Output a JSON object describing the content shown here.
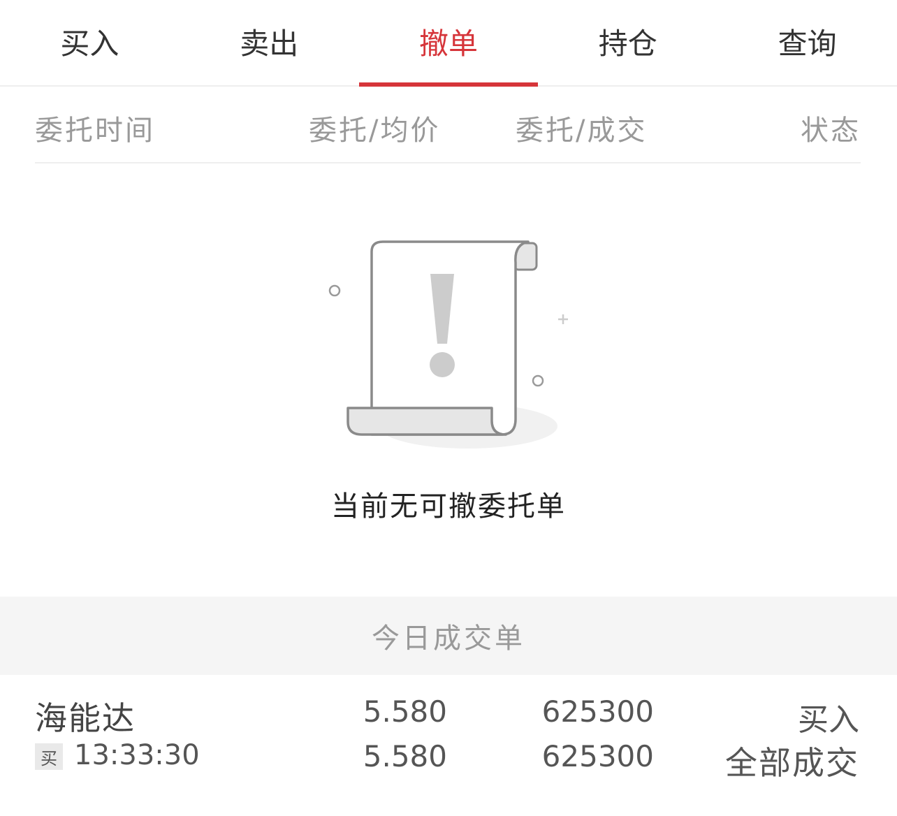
{
  "tabs": [
    {
      "label": "买入",
      "active": false
    },
    {
      "label": "卖出",
      "active": false
    },
    {
      "label": "撤单",
      "active": true
    },
    {
      "label": "持仓",
      "active": false
    },
    {
      "label": "查询",
      "active": false
    }
  ],
  "columns": {
    "time": "委托时间",
    "price": "委托/均价",
    "volume": "委托/成交",
    "status": "状态"
  },
  "empty_state": {
    "icon": "document-exclamation-icon",
    "message": "当前无可撤委托单"
  },
  "today_section": {
    "title": "今日成交单"
  },
  "trades": [
    {
      "name": "海能达",
      "side_badge": "买",
      "time": "13:33:30",
      "order_price": "5.580",
      "avg_price": "5.580",
      "order_volume": "625300",
      "filled_volume": "625300",
      "direction": "买入",
      "status": "全部成交"
    }
  ],
  "colors": {
    "accent": "#d6353a",
    "section_bg": "#f5f5f5",
    "muted_text": "#999999"
  }
}
